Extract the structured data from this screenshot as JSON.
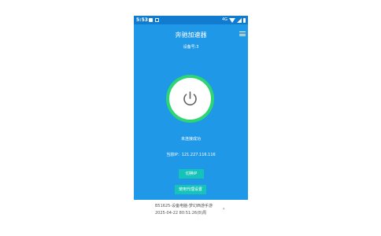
{
  "status_bar": {
    "time": "5:53",
    "network": "4G"
  },
  "app": {
    "title": "奔驰加速器",
    "device_label": "设备号:3"
  },
  "connection": {
    "status": "未连接成功",
    "ip_line": "当前IP：121.227.116.116"
  },
  "buttons": {
    "switch_ip": "切换IP",
    "retry": "使用代理设置"
  },
  "caption": {
    "line1": "B51625-设备电脑-梦幻西游手游",
    "line2": "2025-04-22 80:51:26(8)周"
  },
  "colors": {
    "background": "#1f98e8",
    "status_bar": "#117bd0",
    "ring": "#2ed573",
    "button": "#16c3b8"
  },
  "icons": {
    "power": "power-icon",
    "menu": "hamburger-menu-icon"
  }
}
